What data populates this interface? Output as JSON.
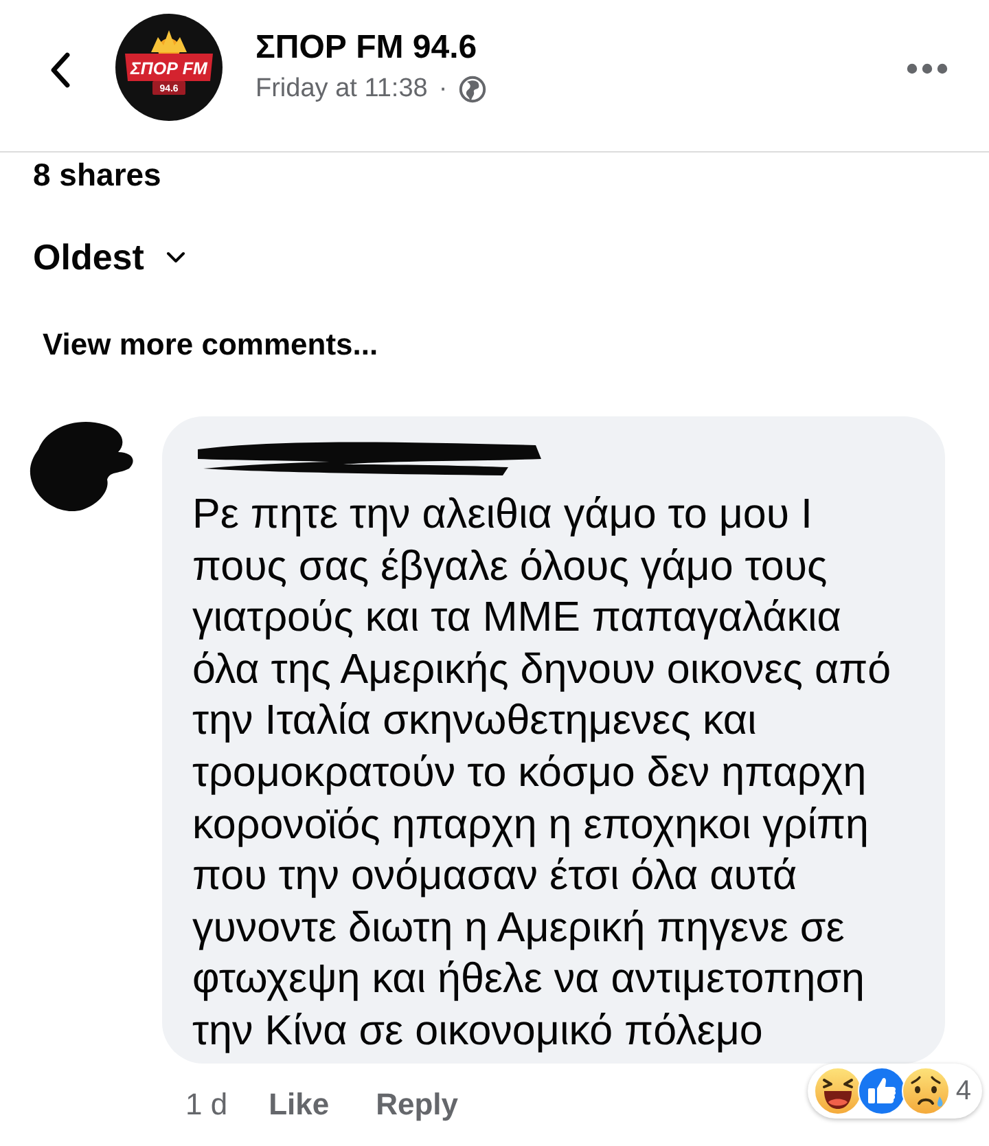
{
  "header": {
    "logo": {
      "text": "ΣΠΟΡ FM",
      "frequency": "94.6"
    },
    "page_name": "ΣΠΟΡ FM 94.6",
    "timestamp": "Friday at 11:38",
    "separator": "·"
  },
  "shares": "8 shares",
  "sort": {
    "label": "Oldest"
  },
  "view_more": "View more comments...",
  "comment": {
    "text": "Ρε πητε την αλειθια γάμο το μου Ι\nπους σας έβγαλε όλους γάμο τους\nγιατρούς και τα ΜΜΕ παπαγαλάκια\nόλα της Αμερικής δηνουν οικονες από\nτην Ιταλία σκηνωθετημενες και\nτρομοκρατούν το κόσμο δεν ηπαρχη\nκορονοϊός ηπαρχη η εποχηκοι γρίπη\nπου την ονόμασαν έτσι όλα αυτά\nγυνοντε διωτη η Αμερική πηγενε σε\nφτωχεψη και ήθελε να αντιμετοπηση\nτην Κίνα σε οικονομικό πόλεμο",
    "age": "1 d",
    "actions": [
      "Like",
      "Reply"
    ],
    "reactions": {
      "icons": [
        {
          "kind": "haha"
        },
        {
          "kind": "like"
        },
        {
          "kind": "sad"
        }
      ],
      "count": "4"
    }
  }
}
